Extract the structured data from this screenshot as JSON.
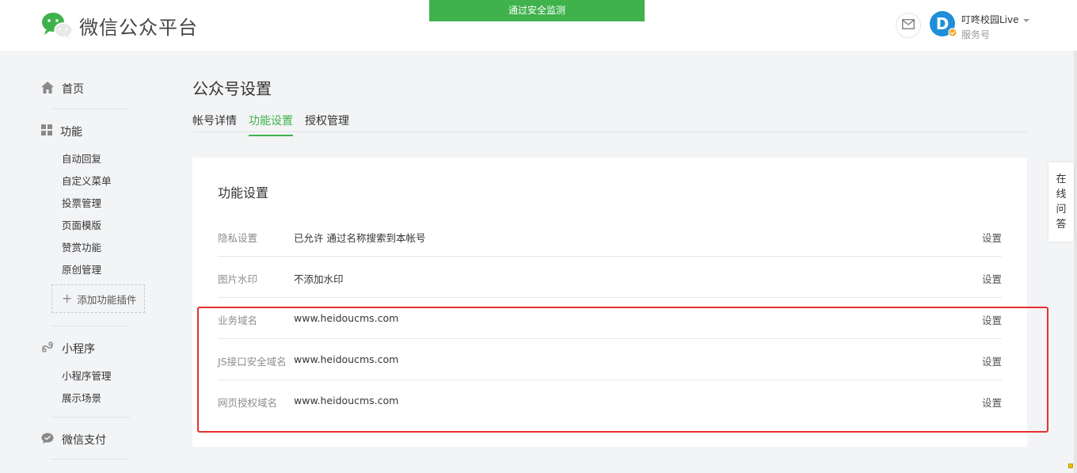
{
  "header": {
    "logo_text": "微信公众平台",
    "banner": "通过安全监测",
    "account_name": "叮咚校园Live",
    "account_type": "服务号",
    "icons": [
      "wechat-logo-icon",
      "mail-icon",
      "avatar"
    ]
  },
  "sidebar": {
    "home": "首页",
    "features": {
      "title": "功能",
      "items": [
        "自动回复",
        "自定义菜单",
        "投票管理",
        "页面模版",
        "赞赏功能",
        "原创管理"
      ]
    },
    "add_plugin": "添加功能插件",
    "miniprogram": {
      "title": "小程序",
      "items": [
        "小程序管理",
        "展示场景"
      ]
    },
    "pay": "微信支付"
  },
  "main": {
    "page_title": "公众号设置",
    "tabs": [
      {
        "label": "帐号详情",
        "active": false
      },
      {
        "label": "功能设置",
        "active": true
      },
      {
        "label": "授权管理",
        "active": false
      }
    ],
    "card_title": "功能设置",
    "rows": [
      {
        "label": "隐私设置",
        "value": "已允许 通过名称搜索到本帐号",
        "action": "设置"
      },
      {
        "label": "图片水印",
        "value": "不添加水印",
        "action": "设置"
      },
      {
        "label": "业务域名",
        "value": "www.heidoucms.com",
        "action": "设置"
      },
      {
        "label": "JS接口安全域名",
        "value": "www.heidoucms.com",
        "action": "设置"
      },
      {
        "label": "网页授权域名",
        "value": "www.heidoucms.com",
        "action": "设置"
      }
    ]
  },
  "float": {
    "online_qa": [
      "在",
      "线",
      "问",
      "答"
    ]
  },
  "colors": {
    "accent": "#3fb24c",
    "highlight": "#e5312e",
    "background": "#f3f4f6"
  }
}
